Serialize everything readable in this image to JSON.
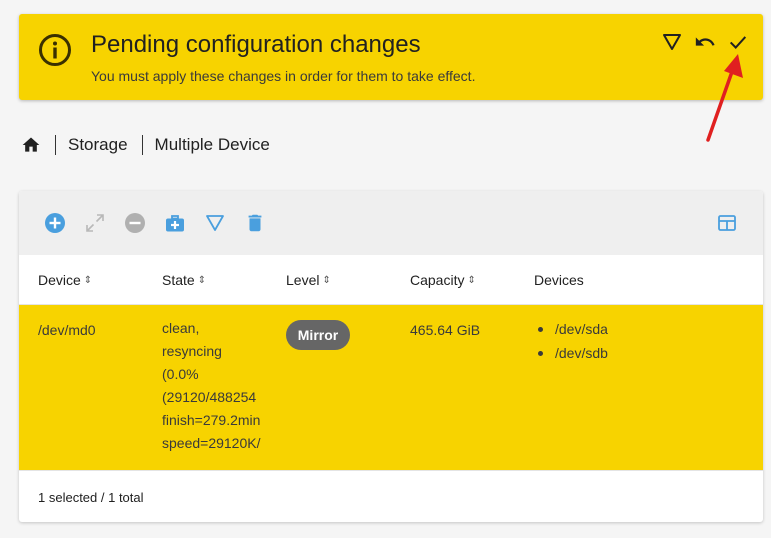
{
  "banner": {
    "title": "Pending configuration changes",
    "subtitle": "You must apply these changes in order for them to take effect.",
    "background": "#f7d300",
    "icon": "info-icon",
    "actions": [
      {
        "icon": "filter-icon"
      },
      {
        "icon": "undo-icon"
      },
      {
        "icon": "check-icon"
      }
    ]
  },
  "annotation": {
    "icon": "arrow-icon",
    "color": "#e02020"
  },
  "breadcrumb": {
    "home_icon": "home-icon",
    "items": [
      "Storage",
      "Multiple Device"
    ]
  },
  "toolbar": {
    "accent": "#4a9fde",
    "icons": [
      "add-icon",
      "expand-icon",
      "remove-icon",
      "recover-icon",
      "filter-icon",
      "delete-icon",
      "columns-icon"
    ]
  },
  "table": {
    "columns": [
      {
        "label": "Device",
        "sortable": true
      },
      {
        "label": "State",
        "sortable": true
      },
      {
        "label": "Level",
        "sortable": true
      },
      {
        "label": "Capacity",
        "sortable": true
      },
      {
        "label": "Devices",
        "sortable": false
      }
    ],
    "rows": [
      {
        "device": "/dev/md0",
        "state_lines": [
          "clean,",
          "resyncing",
          "(0.0%",
          "(29120/488254",
          "finish=279.2min",
          "speed=29120K/"
        ],
        "level": "Mirror",
        "capacity": "465.64 GiB",
        "devices": [
          "/dev/sda",
          "/dev/sdb"
        ],
        "selected": true
      }
    ]
  },
  "footer": {
    "status": "1 selected / 1 total"
  }
}
